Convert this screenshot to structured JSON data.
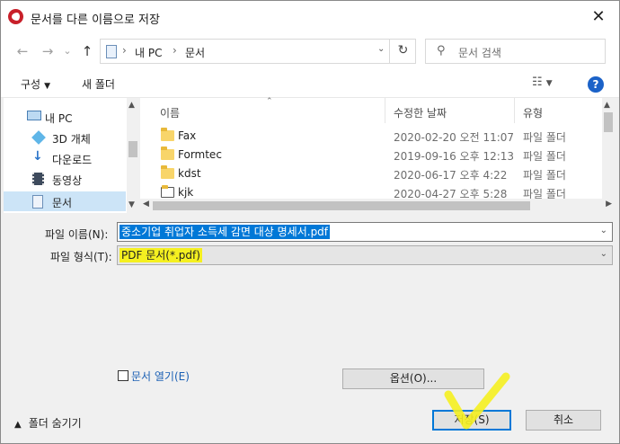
{
  "window": {
    "title": "문서를 다른 이름으로 저장",
    "close_glyph": "✕"
  },
  "nav": {
    "back": "←",
    "forward": "→",
    "down": "⌄",
    "up": "↑",
    "breadcrumb": [
      "내 PC",
      "문서"
    ],
    "breadcrumb_sep": "›",
    "refresh": "↻",
    "search_placeholder": "문서 검색"
  },
  "commands": {
    "organize": "구성",
    "new_folder": "새 폴더",
    "help": "?"
  },
  "sidebar": {
    "items": [
      {
        "label": "내 PC",
        "icon": "pc-icon"
      },
      {
        "label": "3D 개체",
        "icon": "cube-icon"
      },
      {
        "label": "다운로드",
        "icon": "download-icon"
      },
      {
        "label": "동영상",
        "icon": "video-icon"
      },
      {
        "label": "문서",
        "icon": "document-icon",
        "selected": true
      }
    ]
  },
  "file_list": {
    "columns": [
      "이름",
      "수정한 날짜",
      "유형"
    ],
    "rows": [
      {
        "name": "Fax",
        "date": "2020-02-20 오전 11:07",
        "type": "파일 폴더"
      },
      {
        "name": "Formtec",
        "date": "2019-09-16 오후 12:13",
        "type": "파일 폴더"
      },
      {
        "name": "kdst",
        "date": "2020-06-17 오후 4:22",
        "type": "파일 폴더"
      },
      {
        "name": "kjk",
        "date": "2020-04-27 오후 5:28",
        "type": "파일 폴더"
      }
    ]
  },
  "form": {
    "filename_label": "파일 이름(N):",
    "filename_value": "중소기업 취업자 소득세 감면 대상 명세서.pdf",
    "filetype_label": "파일 형식(T):",
    "filetype_value": "PDF 문서(*.pdf)",
    "open_doc_label": "문서 열기(E)",
    "options_button": "옵션(O)...",
    "save_button": "저장(S)",
    "cancel_button": "취소",
    "hide_folders": "폴더 숨기기"
  },
  "colors": {
    "highlight": "#f5f020",
    "selection": "#0078d7",
    "accent": "#1b62c8"
  }
}
